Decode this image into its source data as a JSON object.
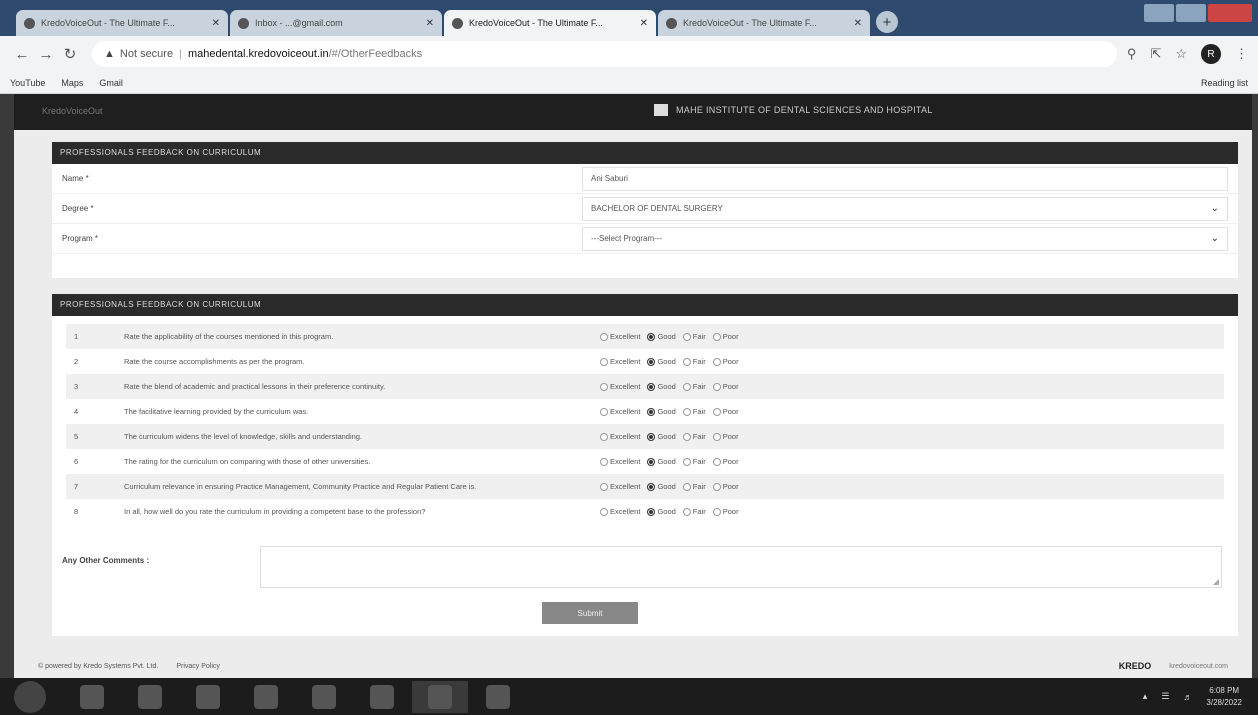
{
  "browser": {
    "tabs": [
      {
        "title": "KredoVoiceOut - The Ultimate F...",
        "active": false
      },
      {
        "title": "Inbox - ...@gmail.com",
        "active": false
      },
      {
        "title": "KredoVoiceOut - The Ultimate F...",
        "active": true
      },
      {
        "title": "KredoVoiceOut - The Ultimate F...",
        "active": false
      }
    ],
    "address": {
      "security": "Not secure",
      "host": "mahedental.kredovoiceout.in",
      "path": "/#/OtherFeedbacks"
    },
    "bookmarks": [
      "YouTube",
      "Maps",
      "Gmail"
    ],
    "reading_list": "Reading list",
    "profile_initial": "R"
  },
  "site": {
    "brand": "KredoVoiceOut",
    "institution": "MAHE INSTITUTE OF DENTAL SCIENCES AND HOSPITAL"
  },
  "form_panel": {
    "title": "PROFESSIONALS FEEDBACK ON CURRICULUM",
    "fields": [
      {
        "label": "Name *",
        "value": "Ani Saburi",
        "dropdown": false
      },
      {
        "label": "Degree *",
        "value": "BACHELOR OF DENTAL SURGERY",
        "dropdown": true
      },
      {
        "label": "Program *",
        "value": "---Select Program---",
        "dropdown": true
      }
    ]
  },
  "question_panel": {
    "title": "PROFESSIONALS FEEDBACK ON CURRICULUM",
    "options": [
      "Excellent",
      "Good",
      "Fair",
      "Poor"
    ],
    "questions": [
      {
        "num": "1",
        "text": "Rate the applicability of the courses mentioned in this program.",
        "selected": "Good"
      },
      {
        "num": "2",
        "text": "Rate the course accomplishments as per the program.",
        "selected": "Good"
      },
      {
        "num": "3",
        "text": "Rate the blend of academic and practical lessons in their preference continuity.",
        "selected": "Good"
      },
      {
        "num": "4",
        "text": "The facilitative learning provided by the curriculum was.",
        "selected": "Good"
      },
      {
        "num": "5",
        "text": "The curriculum widens the level of knowledge, skills and understanding.",
        "selected": "Good"
      },
      {
        "num": "6",
        "text": "The rating for the curriculum on comparing with those of other universities.",
        "selected": "Good"
      },
      {
        "num": "7",
        "text": "Curriculum relevance in ensuring Practice Management, Community Practice and Regular Patient Care is.",
        "selected": "Good"
      },
      {
        "num": "8",
        "text": "In all, how well do you rate the curriculum in providing a competent base to the profession?",
        "selected": "Good"
      }
    ],
    "comments_label": "Any Other Comments :",
    "submit_label": "Submit"
  },
  "footer": {
    "powered": "© powered by Kredo Systems Pvt. Ltd.",
    "privacy": "Privacy Policy",
    "kredo": "KREDO",
    "site": "kredovoiceout.com"
  },
  "taskbar": {
    "time": "6:08 PM",
    "date": "3/28/2022"
  }
}
